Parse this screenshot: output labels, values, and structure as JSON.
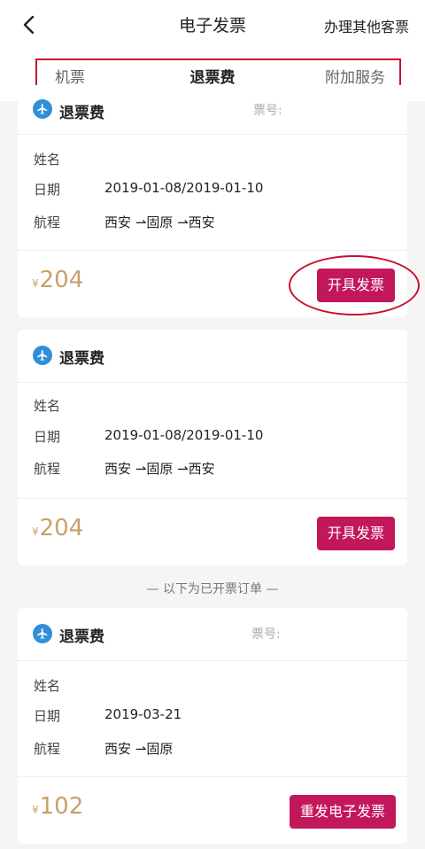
{
  "nav": {
    "title": "电子发票",
    "right_link": "办理其他客票",
    "back_icon": "chevron-left-icon"
  },
  "tabs": [
    {
      "label": "机票"
    },
    {
      "label": "退票费"
    },
    {
      "label": "附加服务"
    }
  ],
  "cards": [
    {
      "title": "退票费",
      "ticket_no_label": "票号:",
      "rows": [
        {
          "label": "姓名",
          "value": ""
        },
        {
          "label": "日期",
          "value": "2019-01-08/2019-01-10"
        },
        {
          "label": "航程",
          "value": "西安 ⇀固原 ⇀西安"
        }
      ],
      "currency": "¥",
      "amount": "204",
      "button": "开具发票"
    },
    {
      "title": "退票费",
      "ticket_no_label": "",
      "rows": [
        {
          "label": "姓名",
          "value": ""
        },
        {
          "label": "日期",
          "value": "2019-01-08/2019-01-10"
        },
        {
          "label": "航程",
          "value": "西安 ⇀固原 ⇀西安"
        }
      ],
      "currency": "¥",
      "amount": "204",
      "button": "开具发票"
    },
    {
      "title": "退票费",
      "ticket_no_label": "票号:",
      "rows": [
        {
          "label": "姓名",
          "value": ""
        },
        {
          "label": "日期",
          "value": "2019-03-21"
        },
        {
          "label": "航程",
          "value": "西安 ⇀固原"
        }
      ],
      "currency": "¥",
      "amount": "102",
      "button": "重发电子发票"
    }
  ],
  "divider": "— 以下为已开票订单 —",
  "colors": {
    "accent": "#c2185b",
    "price": "#c9a06d",
    "highlight": "#c8102e",
    "plane": "#2f8fd8"
  }
}
